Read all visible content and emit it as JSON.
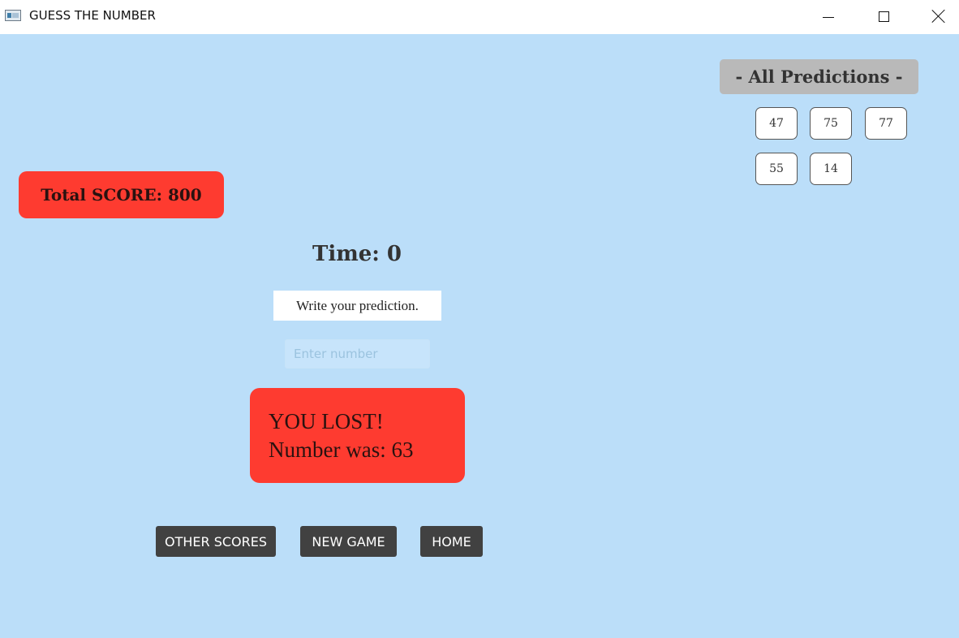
{
  "window": {
    "title": "GUESS THE NUMBER"
  },
  "score": {
    "label": "Total SCORE: 800"
  },
  "predictions": {
    "header": "- All Predictions -",
    "values": [
      "47",
      "75",
      "77",
      "55",
      "14"
    ]
  },
  "timer": {
    "label": "Time: 0"
  },
  "instruction": {
    "text": "Write your prediction."
  },
  "input": {
    "placeholder": "Enter number",
    "value": ""
  },
  "result": {
    "line1": "YOU LOST!",
    "line2": "Number was: 63"
  },
  "buttons": {
    "other_scores": "OTHER SCORES",
    "new_game": "NEW GAME",
    "home": "HOME"
  },
  "colors": {
    "background": "#bbdef9",
    "alert": "#fe3b30",
    "header_gray": "#b9b9b9",
    "button_dark": "#414141"
  }
}
